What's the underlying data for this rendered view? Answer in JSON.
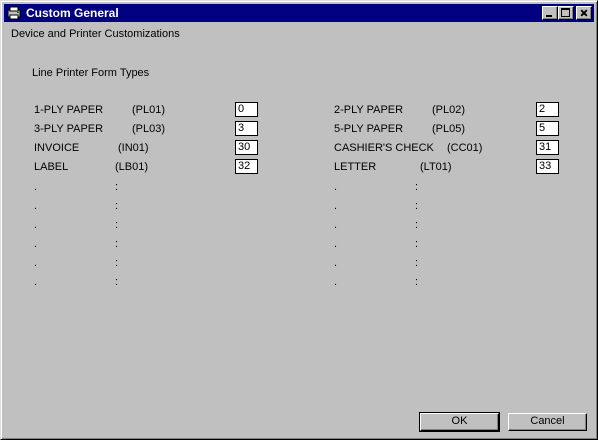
{
  "window": {
    "title": "Custom General"
  },
  "header": {
    "subtitle": "Device and Printer Customizations",
    "section": "Line Printer Form Types"
  },
  "forms": [
    {
      "name": "1-PLY PAPER",
      "code": "(PL01)",
      "value": "0"
    },
    {
      "name": "2-PLY PAPER",
      "code": "(PL02)",
      "value": "2"
    },
    {
      "name": "3-PLY PAPER",
      "code": "(PL03)",
      "value": "3"
    },
    {
      "name": "5-PLY PAPER",
      "code": "(PL05)",
      "value": "5"
    },
    {
      "name": "INVOICE",
      "code": "(IN01)",
      "value": "30"
    },
    {
      "name": "CASHIER'S CHECK",
      "code": "(CC01)",
      "value": "31"
    },
    {
      "name": "LABEL",
      "code": "(LB01)",
      "value": "32"
    },
    {
      "name": "LETTER",
      "code": "(LT01)",
      "value": "33"
    }
  ],
  "placeholders": {
    "name": ".",
    "code": ":"
  },
  "buttons": {
    "ok": "OK",
    "cancel": "Cancel"
  },
  "icons": {
    "app": "printer-app-icon",
    "minimize": "minimize-icon",
    "maximize": "maximize-icon",
    "close": "close-icon"
  }
}
